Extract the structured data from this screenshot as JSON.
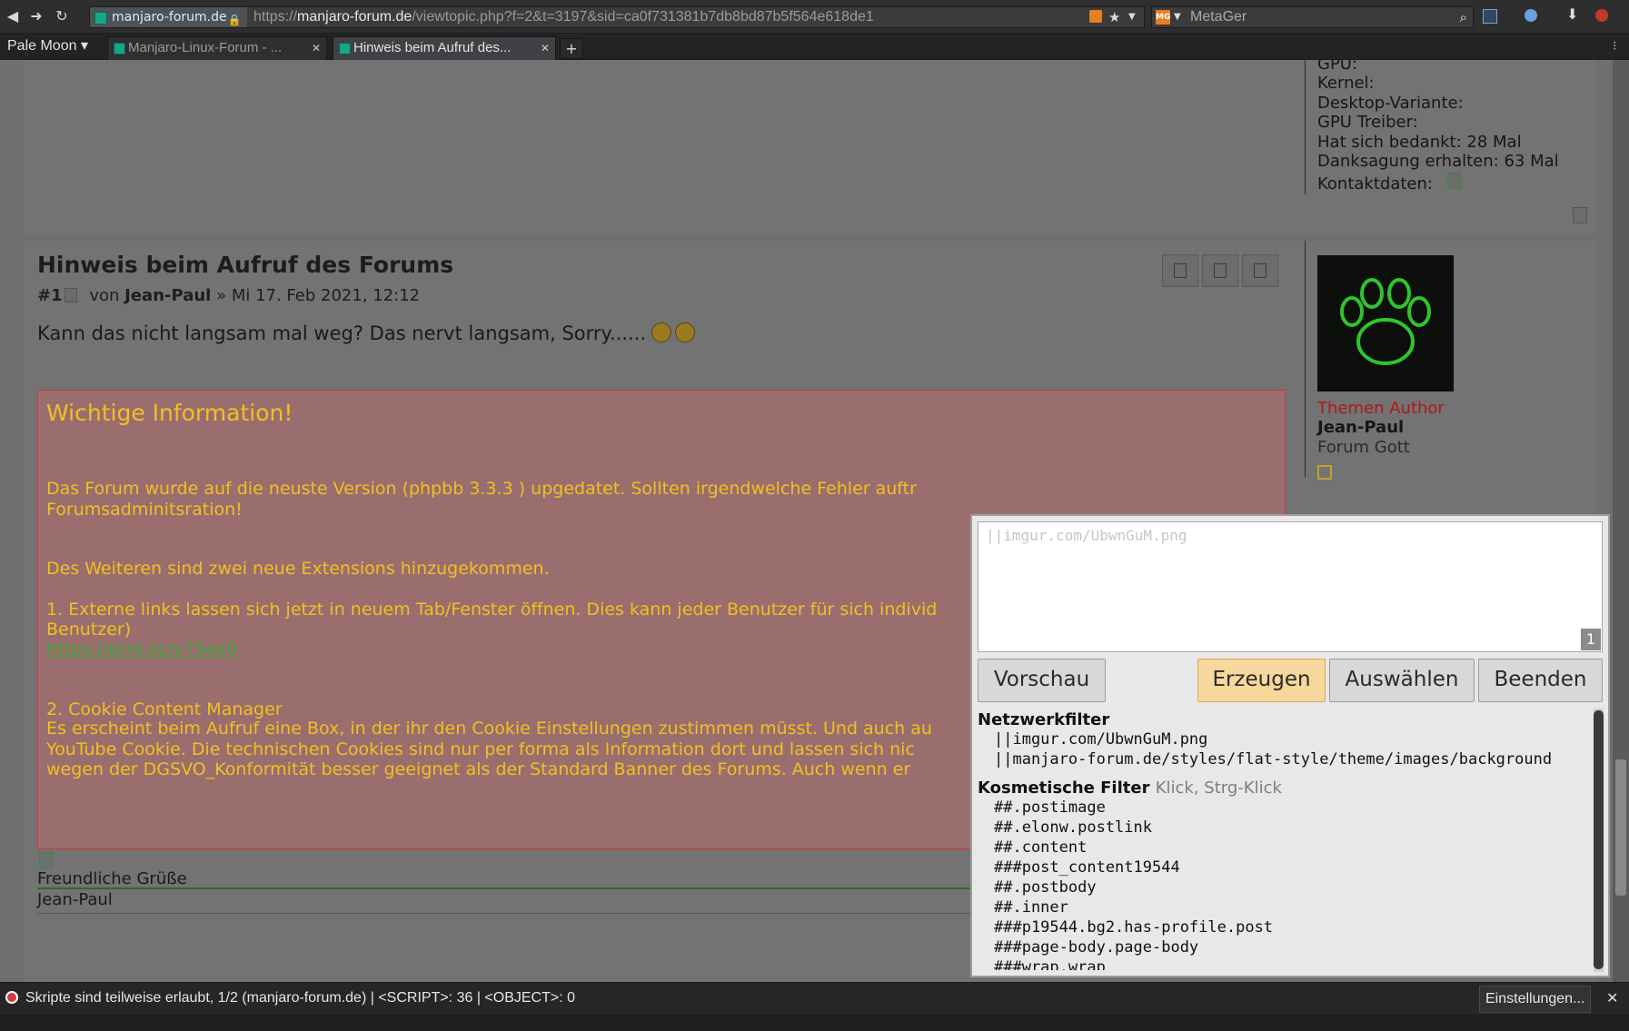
{
  "browser": {
    "site_identity": "manjaro-forum.de",
    "url_prefix": "https://",
    "url_host": "manjaro-forum.de",
    "url_path": "/viewtopic.php?f=2&t=3197&sid=ca0f731381b7db8bd87b5f564e618de1",
    "search_engine": "MetaGer",
    "app_menu": "Pale Moon",
    "tabs": [
      {
        "label": "Manjaro-Linux-Forum - ...",
        "active": false
      },
      {
        "label": "Hinweis beim Aufruf des...",
        "active": true
      }
    ],
    "new_tab": "+"
  },
  "previous_post_profile": {
    "lines": [
      "GPU:",
      "Kernel:",
      "Desktop-Variante:",
      "GPU Treiber:",
      "Hat sich bedankt: 28 Mal",
      "Danksagung erhalten: 63 Mal",
      "Kontaktdaten:"
    ]
  },
  "post": {
    "title": "Hinweis beim Aufruf des Forums",
    "number": "#1",
    "by": "von",
    "author": "Jean-Paul",
    "date": "» Mi 17. Feb 2021, 12:12",
    "body": "Kann das nicht langsam mal weg? Das nervt langsam, Sorry......"
  },
  "profile": {
    "role": "Themen Author",
    "username": "Jean-Paul",
    "rank": "Forum Gott",
    "colors": {
      "role": "#b01818"
    }
  },
  "notice": {
    "title": "Wichtige Information!",
    "lines": [
      "Das Forum wurde auf die neuste Version (phpbb 3.3.3 ) upgedatet. Sollten irgendwelche Fehler auftr",
      "Forumsadminitsration!",
      "Des Weiteren sind zwei neue Extensions hinzugekommen.",
      "1. Externe links lassen sich jetzt in neuem Tab/Fenster öffnen. Dies kann jeder Benutzer für sich individ",
      "Benutzer)",
      "2. Cookie Content Manager",
      "Es erscheint beim Aufruf eine Box, in der ihr den Cookie Einstellungen zustimmen müsst. Und auch au",
      "YouTube Cookie. Die technischen Cookies sind nur per forma als Information dort und lassen sich nic",
      "wegen der DGSVO_Konformität besser geeignet als der Standard Banner des Forums. Auch wenn er"
    ],
    "link": "https://prnt.sc/y75ex0",
    "colors": {
      "background": "#9a6e6e",
      "border": "#c83b3b",
      "text": "#f0c020"
    }
  },
  "signature": {
    "greeting": "Freundliche Grüße",
    "name": "Jean-Paul"
  },
  "picker": {
    "textarea_value": "||imgur.com/UbwnGuM.png",
    "count": "1",
    "buttons": {
      "preview": "Vorschau",
      "create": "Erzeugen",
      "select": "Auswählen",
      "quit": "Beenden"
    },
    "network_heading": "Netzwerkfilter",
    "network_rules": [
      "||imgur.com/UbwnGuM.png",
      "||manjaro-forum.de/styles/flat-style/theme/images/background"
    ],
    "cosmetic_heading": "Kosmetische Filter",
    "cosmetic_hint": "Klick, Strg-Klick",
    "cosmetic_rules": [
      "##.postimage",
      "##.elonw.postlink",
      "##.content",
      "###post_content19544",
      "##.postbody",
      "##.inner",
      "###p19544.bg2.has-profile.post",
      "###page-body.page-body",
      "###wrap.wrap"
    ],
    "colors": {
      "primary_button": "#f8d79c"
    }
  },
  "status": {
    "text": "Skripte sind teilweise erlaubt, 1/2 (manjaro-forum.de)  |  <SCRIPT>: 36  |  <OBJECT>: 0",
    "settings": "Einstellungen...",
    "close": "✕"
  }
}
